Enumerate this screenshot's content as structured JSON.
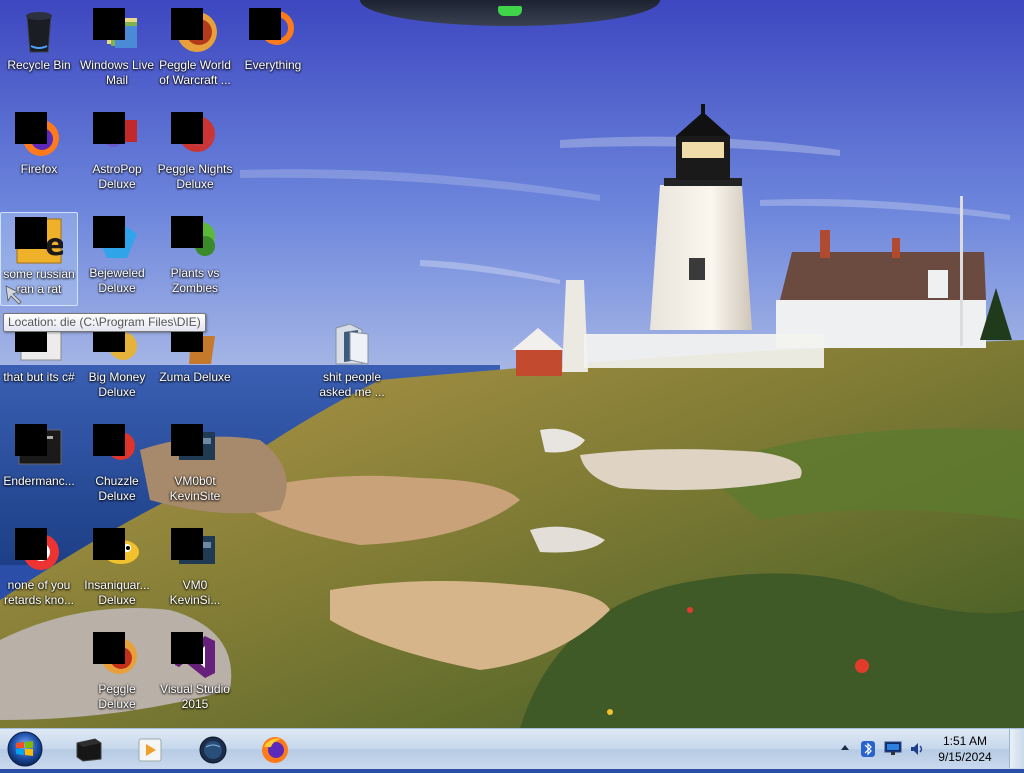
{
  "desktop": {
    "icons": [
      {
        "id": "recycle-bin",
        "label": "Recycle Bin",
        "icon": "recycle-bin-icon",
        "redacted": false
      },
      {
        "id": "windows-live-mail",
        "label": "Windows Live\nMail",
        "icon": "mail-icon",
        "redacted": true
      },
      {
        "id": "peggle-world-of-warcraft",
        "label": "Peggle World\nof Warcraft ...",
        "icon": "peggle-icon",
        "redacted": true
      },
      {
        "id": "everything",
        "label": "Everything",
        "icon": "search-icon",
        "redacted": true
      },
      {
        "id": "firefox",
        "label": "Firefox",
        "icon": "firefox-icon",
        "redacted": true
      },
      {
        "id": "astropop-deluxe",
        "label": "AstroPop\nDeluxe",
        "icon": "astropop-icon",
        "redacted": true
      },
      {
        "id": "peggle-nights-deluxe",
        "label": "Peggle Nights\nDeluxe",
        "icon": "peggle-nights-icon",
        "redacted": true
      },
      {
        "id": "some-russian-ran-a-rat",
        "label": "some russian\nran a rat",
        "icon": "die-icon",
        "redacted": true
      },
      {
        "id": "bejeweled-deluxe",
        "label": "Bejeweled\nDeluxe",
        "icon": "bejeweled-icon",
        "redacted": true
      },
      {
        "id": "plants-vs-zombies",
        "label": "Plants vs\nZombies",
        "icon": "plants-vs-zombies-icon",
        "redacted": true
      },
      {
        "id": "that-but-its-csharp",
        "label": "that but its c#",
        "icon": "application-icon",
        "redacted": true
      },
      {
        "id": "big-money-deluxe",
        "label": "Big Money\nDeluxe",
        "icon": "big-money-icon",
        "redacted": true
      },
      {
        "id": "zuma-deluxe",
        "label": "Zuma Deluxe",
        "icon": "zuma-icon",
        "redacted": true
      },
      {
        "id": "shit-people-asked-me",
        "label": "shit people\nasked me ...",
        "icon": "folder-icon",
        "redacted": false
      },
      {
        "id": "endermanch",
        "label": "Endermanc...",
        "icon": "console-icon",
        "redacted": true
      },
      {
        "id": "chuzzle-deluxe",
        "label": "Chuzzle\nDeluxe",
        "icon": "chuzzle-icon",
        "redacted": true
      },
      {
        "id": "vm0b0t-kevinsite",
        "label": "VM0b0t\nKevinSite",
        "icon": "vm-icon",
        "redacted": true
      },
      {
        "id": "none-of-you-retards",
        "label": "none of you\nretards kno...",
        "icon": "opera-icon",
        "redacted": true
      },
      {
        "id": "insaniquarium-deluxe",
        "label": "Insaniquar...\nDeluxe",
        "icon": "fish-icon",
        "redacted": true
      },
      {
        "id": "vm0-kevinsite",
        "label": "VM0\nKevinSi...",
        "icon": "vm-icon",
        "redacted": true
      },
      {
        "id": "peggle-deluxe",
        "label": "Peggle Deluxe",
        "icon": "peggle-deluxe-icon",
        "redacted": true
      },
      {
        "id": "visual-studio-2015",
        "label": "Visual Studio\n2015",
        "icon": "visual-studio-icon",
        "redacted": true
      }
    ],
    "selected_icon": "some-russian-ran-a-rat",
    "tooltip": "Location: die (C:\\Program Files\\DIE)"
  },
  "taskbar": {
    "start_label": "Start",
    "pinned": [
      {
        "id": "tb-explorer",
        "icon": "black-box-icon"
      },
      {
        "id": "tb-media",
        "icon": "media-player-icon"
      },
      {
        "id": "tb-globe",
        "icon": "globe-icon"
      },
      {
        "id": "tb-firefox",
        "icon": "firefox-icon"
      }
    ],
    "tray": {
      "icons": [
        "show-hidden-icons-icon",
        "bluetooth-icon",
        "network-icon",
        "volume-icon"
      ],
      "time": "1:51 AM",
      "date": "9/15/2024"
    }
  },
  "colors": {
    "sky_top": "#4150c8",
    "sky_bottom": "#8fa6e0",
    "sea": "#2b5fa8",
    "grass": "#9a8a3a",
    "accent_led": "#3fd44a",
    "taskbar": "#c7d8ec"
  }
}
